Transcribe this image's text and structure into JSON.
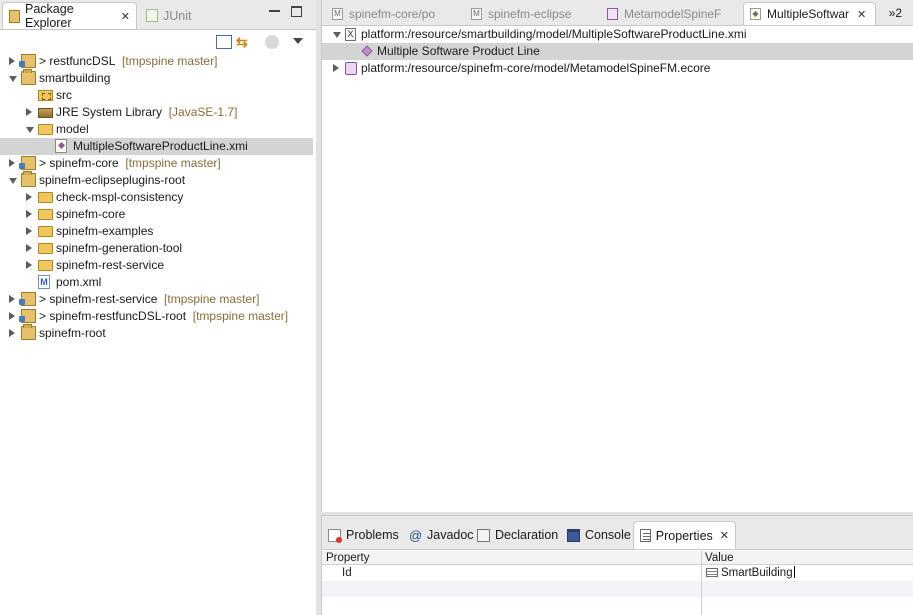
{
  "package_explorer": {
    "tabs": [
      {
        "label": "Package Explorer",
        "active": true,
        "icon": "package-explorer-icon"
      },
      {
        "label": "JUnit",
        "active": false,
        "icon": "junit-icon"
      }
    ],
    "tree": [
      {
        "label": "> restfuncDSL",
        "decoration": "[tmpspine master]",
        "indent": 0,
        "twisty": "closed",
        "icon": "git-project-icon"
      },
      {
        "label": "smartbuilding",
        "decoration": "",
        "indent": 0,
        "twisty": "open",
        "icon": "project-icon"
      },
      {
        "label": "src",
        "decoration": "",
        "indent": 1,
        "twisty": "none",
        "icon": "source-folder-icon"
      },
      {
        "label": "JRE System Library",
        "decoration": "[JavaSE-1.7]",
        "indent": 1,
        "twisty": "closed",
        "icon": "library-icon"
      },
      {
        "label": "model",
        "decoration": "",
        "indent": 1,
        "twisty": "open",
        "icon": "folder-icon"
      },
      {
        "label": "MultipleSoftwareProductLine.xmi",
        "decoration": "",
        "indent": 2,
        "twisty": "none",
        "icon": "xmi-file-icon",
        "selected": true
      },
      {
        "label": "> spinefm-core",
        "decoration": "[tmpspine master]",
        "indent": 0,
        "twisty": "closed",
        "icon": "git-project-icon"
      },
      {
        "label": "spinefm-eclipseplugins-root",
        "decoration": "",
        "indent": 0,
        "twisty": "open",
        "icon": "project-icon"
      },
      {
        "label": "check-mspl-consistency",
        "decoration": "",
        "indent": 1,
        "twisty": "closed",
        "icon": "folder-icon"
      },
      {
        "label": "spinefm-core",
        "decoration": "",
        "indent": 1,
        "twisty": "closed",
        "icon": "folder-icon"
      },
      {
        "label": "spinefm-examples",
        "decoration": "",
        "indent": 1,
        "twisty": "closed",
        "icon": "folder-icon"
      },
      {
        "label": "spinefm-generation-tool",
        "decoration": "",
        "indent": 1,
        "twisty": "closed",
        "icon": "folder-icon"
      },
      {
        "label": "spinefm-rest-service",
        "decoration": "",
        "indent": 1,
        "twisty": "closed",
        "icon": "folder-icon"
      },
      {
        "label": "pom.xml",
        "decoration": "",
        "indent": 1,
        "twisty": "none",
        "icon": "maven-pom-icon"
      },
      {
        "label": "> spinefm-rest-service",
        "decoration": "[tmpspine master]",
        "indent": 0,
        "twisty": "closed",
        "icon": "git-project-icon"
      },
      {
        "label": "> spinefm-restfuncDSL-root",
        "decoration": "[tmpspine master]",
        "indent": 0,
        "twisty": "closed",
        "icon": "git-project-icon"
      },
      {
        "label": "spinefm-root",
        "decoration": "",
        "indent": 0,
        "twisty": "closed",
        "icon": "project-icon"
      }
    ]
  },
  "editor": {
    "tabs": [
      {
        "label": "spinefm-core/po",
        "active": false,
        "icon": "maven-file-icon"
      },
      {
        "label": "spinefm-eclipse",
        "active": false,
        "icon": "maven-file-icon"
      },
      {
        "label": "MetamodelSpineF",
        "active": false,
        "icon": "ecore-icon"
      },
      {
        "label": "MultipleSoftwar",
        "active": true,
        "icon": "xmi-editor-icon"
      }
    ],
    "overflow_label": "»2",
    "tree": [
      {
        "label": "platform:/resource/smartbuilding/model/MultipleSoftwareProductLine.xmi",
        "indent": 0,
        "twisty": "open",
        "icon": "xmi-resource-icon"
      },
      {
        "label": "Multiple Software Product Line",
        "indent": 1,
        "twisty": "none",
        "icon": "model-element-icon",
        "selected": true
      },
      {
        "label": "platform:/resource/spinefm-core/model/MetamodelSpineFM.ecore",
        "indent": 0,
        "twisty": "closed",
        "icon": "ecore-package-icon"
      }
    ]
  },
  "bottom_panel": {
    "tabs": [
      {
        "label": "Problems",
        "active": false,
        "icon": "problems-icon"
      },
      {
        "label": "Javadoc",
        "active": false,
        "icon": "javadoc-icon"
      },
      {
        "label": "Declaration",
        "active": false,
        "icon": "declaration-icon"
      },
      {
        "label": "Console",
        "active": false,
        "icon": "console-icon"
      },
      {
        "label": "Properties",
        "active": true,
        "icon": "properties-icon"
      }
    ],
    "columns": [
      "Property",
      "Value"
    ],
    "rows": [
      {
        "property": "Id",
        "value": "SmartBuilding"
      }
    ]
  }
}
